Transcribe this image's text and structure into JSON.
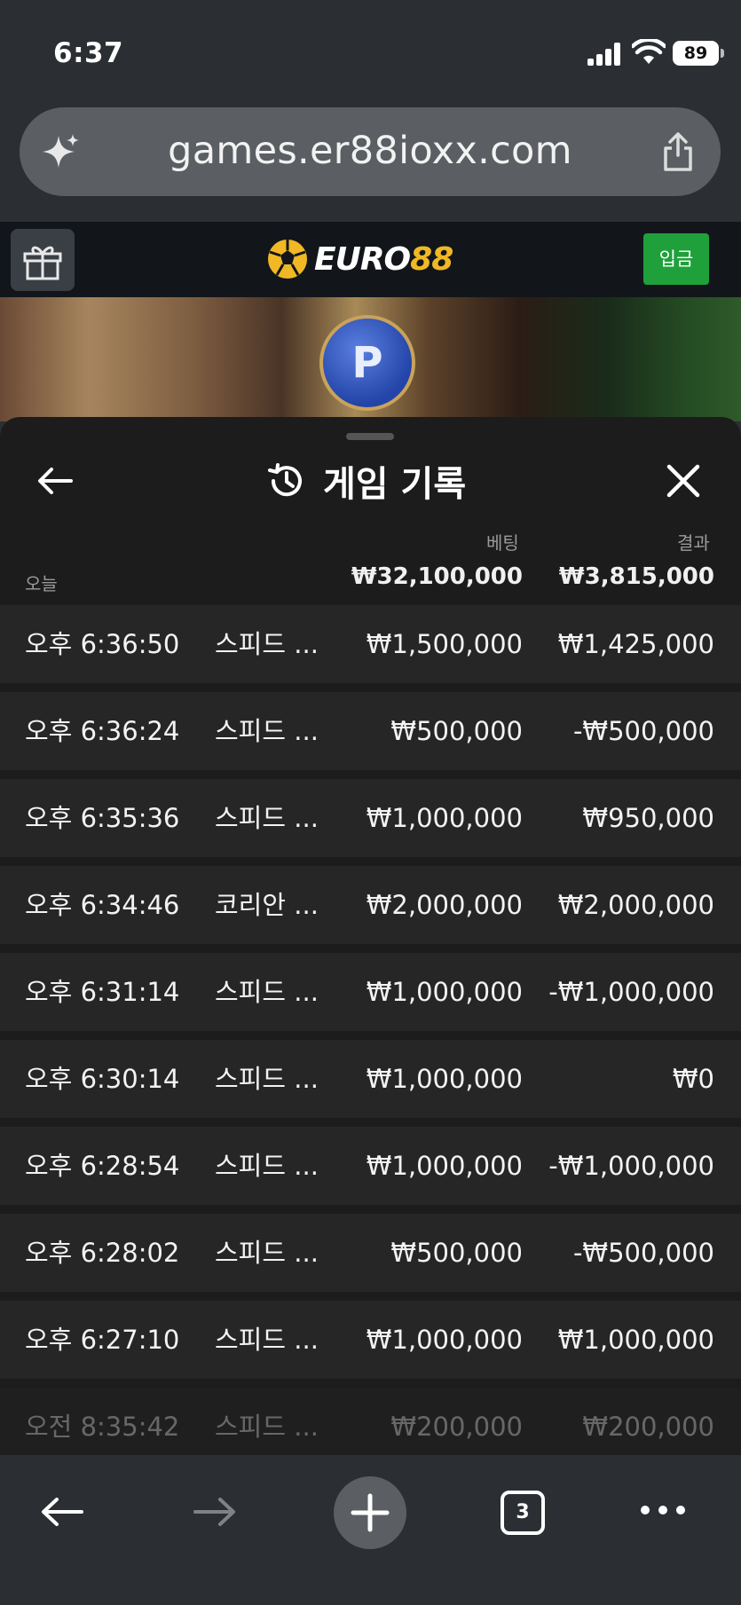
{
  "status": {
    "time": "6:37",
    "battery": "89"
  },
  "browser": {
    "url": "games.er88ioxx.com",
    "tab_count": "3"
  },
  "site": {
    "logo_text_a": "EURO",
    "logo_text_b": "88",
    "deposit_label": "입금"
  },
  "game": {
    "coin_letter": "P"
  },
  "sheet": {
    "title": "게임 기록",
    "col_bet": "베팅",
    "col_result": "결과",
    "day_label": "오늘",
    "total_bet": "₩32,100,000",
    "total_result": "₩3,815,000",
    "rows": [
      {
        "time": "오후 6:36:50",
        "game": "스피드 ...",
        "bet": "₩1,500,000",
        "result": "₩1,425,000"
      },
      {
        "time": "오후 6:36:24",
        "game": "스피드 ...",
        "bet": "₩500,000",
        "result": "-₩500,000"
      },
      {
        "time": "오후 6:35:36",
        "game": "스피드 ...",
        "bet": "₩1,000,000",
        "result": "₩950,000"
      },
      {
        "time": "오후 6:34:46",
        "game": "코리안 ...",
        "bet": "₩2,000,000",
        "result": "₩2,000,000"
      },
      {
        "time": "오후 6:31:14",
        "game": "스피드 ...",
        "bet": "₩1,000,000",
        "result": "-₩1,000,000"
      },
      {
        "time": "오후 6:30:14",
        "game": "스피드 ...",
        "bet": "₩1,000,000",
        "result": "₩0"
      },
      {
        "time": "오후 6:28:54",
        "game": "스피드 ...",
        "bet": "₩1,000,000",
        "result": "-₩1,000,000"
      },
      {
        "time": "오후 6:28:02",
        "game": "스피드 ...",
        "bet": "₩500,000",
        "result": "-₩500,000"
      },
      {
        "time": "오후 6:27:10",
        "game": "스피드 ...",
        "bet": "₩1,000,000",
        "result": "₩1,000,000"
      },
      {
        "time": "오전 8:35:42",
        "game": "스피드 ...",
        "bet": "₩200,000",
        "result": "₩200,000"
      }
    ]
  },
  "icons": {
    "signal": "cellular-signal-icon",
    "wifi": "wifi-icon",
    "sparkle": "sparkle-icon",
    "share": "share-icon",
    "gift": "gift-icon",
    "back": "back-arrow-icon",
    "history": "history-clock-icon",
    "close": "close-icon",
    "plus": "plus-icon",
    "more": "more-dots-icon"
  },
  "colors": {
    "accent_gold": "#f0b824",
    "deposit_green": "#1fa03b",
    "sheet_bg": "#1c1c1c",
    "row_bg": "#262626"
  }
}
